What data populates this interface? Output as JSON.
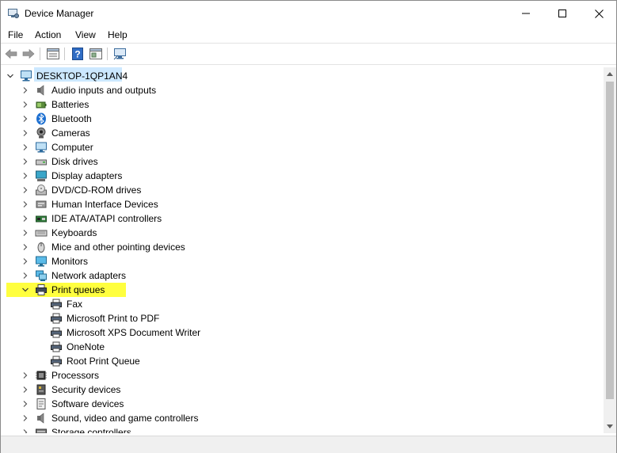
{
  "window": {
    "title": "Device Manager",
    "controls": [
      "minimize-icon",
      "maximize-icon",
      "close-icon"
    ]
  },
  "menu": [
    "File",
    "Action",
    "View",
    "Help"
  ],
  "toolbar": {
    "icons": [
      "back-arrow-icon",
      "forward-arrow-icon",
      "properties-icon",
      "help-icon",
      "show-hide-icon",
      "scan-hardware-icon"
    ]
  },
  "tree": {
    "root": "DESKTOP-1QP1AN4",
    "categories": [
      {
        "label": "Audio inputs and outputs",
        "icon": "speaker-icon",
        "expanded": false
      },
      {
        "label": "Batteries",
        "icon": "battery-icon",
        "expanded": false
      },
      {
        "label": "Bluetooth",
        "icon": "bluetooth-icon",
        "expanded": false
      },
      {
        "label": "Cameras",
        "icon": "camera-icon",
        "expanded": false
      },
      {
        "label": "Computer",
        "icon": "computer-icon",
        "expanded": false
      },
      {
        "label": "Disk drives",
        "icon": "disk-drive-icon",
        "expanded": false
      },
      {
        "label": "Display adapters",
        "icon": "display-adapter-icon",
        "expanded": false
      },
      {
        "label": "DVD/CD-ROM drives",
        "icon": "dvd-drive-icon",
        "expanded": false
      },
      {
        "label": "Human Interface Devices",
        "icon": "hid-icon",
        "expanded": false
      },
      {
        "label": "IDE ATA/ATAPI controllers",
        "icon": "ide-controller-icon",
        "expanded": false
      },
      {
        "label": "Keyboards",
        "icon": "keyboard-icon",
        "expanded": false
      },
      {
        "label": "Mice and other pointing devices",
        "icon": "mouse-icon",
        "expanded": false
      },
      {
        "label": "Monitors",
        "icon": "monitor-icon",
        "expanded": false
      },
      {
        "label": "Network adapters",
        "icon": "network-adapter-icon",
        "expanded": false
      },
      {
        "label": "Print queues",
        "icon": "printer-icon",
        "expanded": true,
        "highlighted": true,
        "children": [
          "Fax",
          "Microsoft Print to PDF",
          "Microsoft XPS Document Writer",
          "OneNote",
          "Root Print Queue"
        ]
      },
      {
        "label": "Processors",
        "icon": "processor-icon",
        "expanded": false
      },
      {
        "label": "Security devices",
        "icon": "security-device-icon",
        "expanded": false
      },
      {
        "label": "Software devices",
        "icon": "software-device-icon",
        "expanded": false
      },
      {
        "label": "Sound, video and game controllers",
        "icon": "sound-controller-icon",
        "expanded": false
      },
      {
        "label": "Storage controllers",
        "icon": "storage-controller-icon",
        "expanded": false
      }
    ]
  },
  "colors": {
    "highlight": "#ffff3f",
    "selection": "#cce8ff"
  }
}
